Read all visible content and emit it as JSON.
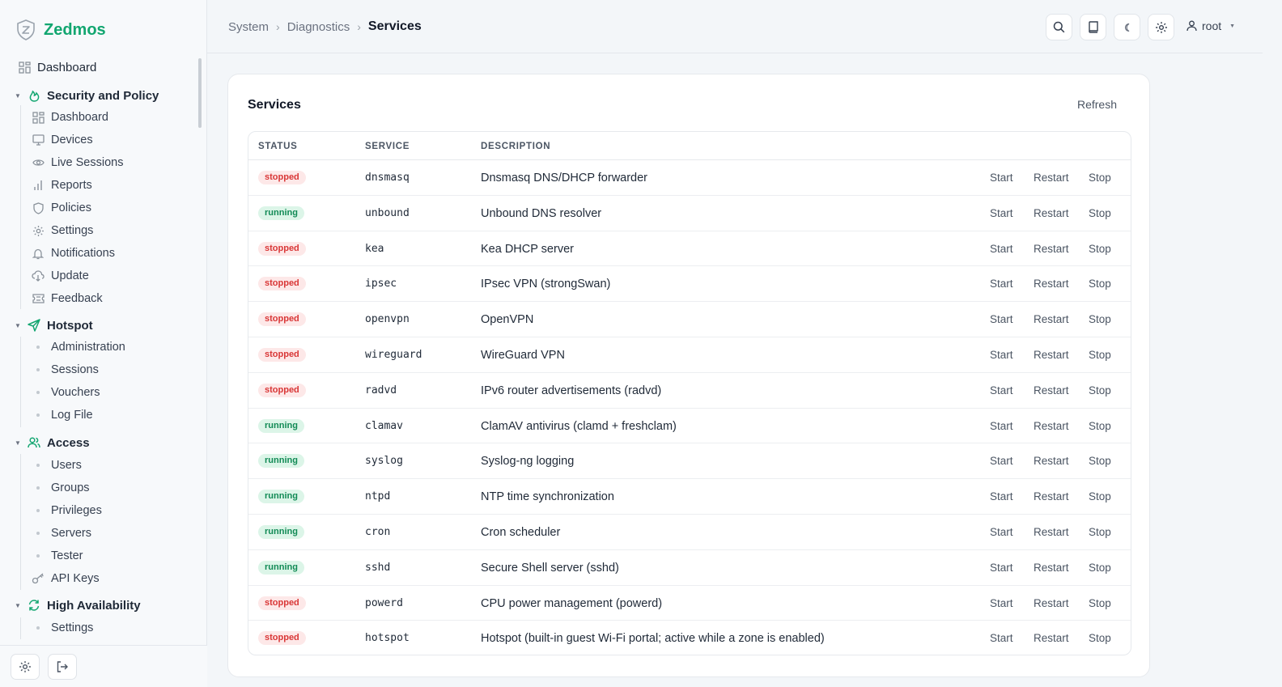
{
  "brand": {
    "name": "Zedmos",
    "accent": "#12a670"
  },
  "sidebar": {
    "top": {
      "label": "Dashboard",
      "icon": "grid-icon"
    },
    "groups": [
      {
        "label": "Security and Policy",
        "icon": "flame-icon",
        "items": [
          {
            "label": "Dashboard",
            "icon": "grid-icon"
          },
          {
            "label": "Devices",
            "icon": "monitor-icon"
          },
          {
            "label": "Live Sessions",
            "icon": "eye-icon"
          },
          {
            "label": "Reports",
            "icon": "bar-chart-icon"
          },
          {
            "label": "Policies",
            "icon": "shield-icon"
          },
          {
            "label": "Settings",
            "icon": "gear-icon"
          },
          {
            "label": "Notifications",
            "icon": "bell-icon"
          },
          {
            "label": "Update",
            "icon": "cloud-download-icon"
          },
          {
            "label": "Feedback",
            "icon": "ticket-icon"
          }
        ]
      },
      {
        "label": "Hotspot",
        "icon": "send-icon",
        "items": [
          {
            "label": "Administration"
          },
          {
            "label": "Sessions"
          },
          {
            "label": "Vouchers"
          },
          {
            "label": "Log File"
          }
        ]
      },
      {
        "label": "Access",
        "icon": "users-icon",
        "items": [
          {
            "label": "Users"
          },
          {
            "label": "Groups"
          },
          {
            "label": "Privileges"
          },
          {
            "label": "Servers"
          },
          {
            "label": "Tester"
          },
          {
            "label": "API Keys",
            "icon": "key-icon"
          }
        ]
      },
      {
        "label": "High Availability",
        "icon": "refresh-icon",
        "items": [
          {
            "label": "Settings"
          }
        ]
      }
    ]
  },
  "breadcrumb": {
    "items": [
      "System",
      "Diagnostics"
    ],
    "current": "Services"
  },
  "header": {
    "user": "root"
  },
  "card": {
    "title": "Services",
    "refresh_label": "Refresh",
    "columns": {
      "status": "STATUS",
      "service": "SERVICE",
      "description": "DESCRIPTION"
    },
    "actions": {
      "start": "Start",
      "restart": "Restart",
      "stop": "Stop"
    },
    "rows": [
      {
        "status": "stopped",
        "service": "dnsmasq",
        "description": "Dnsmasq DNS/DHCP forwarder"
      },
      {
        "status": "running",
        "service": "unbound",
        "description": "Unbound DNS resolver"
      },
      {
        "status": "stopped",
        "service": "kea",
        "description": "Kea DHCP server"
      },
      {
        "status": "stopped",
        "service": "ipsec",
        "description": "IPsec VPN (strongSwan)"
      },
      {
        "status": "stopped",
        "service": "openvpn",
        "description": "OpenVPN"
      },
      {
        "status": "stopped",
        "service": "wireguard",
        "description": "WireGuard VPN"
      },
      {
        "status": "stopped",
        "service": "radvd",
        "description": "IPv6 router advertisements (radvd)"
      },
      {
        "status": "running",
        "service": "clamav",
        "description": "ClamAV antivirus (clamd + freshclam)"
      },
      {
        "status": "running",
        "service": "syslog",
        "description": "Syslog-ng logging"
      },
      {
        "status": "running",
        "service": "ntpd",
        "description": "NTP time synchronization"
      },
      {
        "status": "running",
        "service": "cron",
        "description": "Cron scheduler"
      },
      {
        "status": "running",
        "service": "sshd",
        "description": "Secure Shell server (sshd)"
      },
      {
        "status": "stopped",
        "service": "powerd",
        "description": "CPU power management (powerd)"
      },
      {
        "status": "stopped",
        "service": "hotspot",
        "description": "Hotspot (built-in guest Wi-Fi portal; active while a zone is enabled)"
      }
    ]
  }
}
